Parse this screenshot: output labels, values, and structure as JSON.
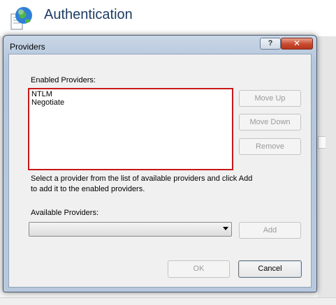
{
  "background": {
    "page_title": "Authentication"
  },
  "dialog": {
    "title": "Providers",
    "help_label": "?",
    "close_label": "✕",
    "enabled_label": "Enabled Providers:",
    "enabled_providers": [
      "NTLM",
      "Negotiate"
    ],
    "buttons": {
      "move_up": "Move Up",
      "move_down": "Move Down",
      "remove": "Remove",
      "add": "Add",
      "ok": "OK",
      "cancel": "Cancel"
    },
    "instruction_line1": "Select a provider from the list of available providers and click Add",
    "instruction_line2": "to add it to the enabled providers.",
    "available_label": "Available Providers:",
    "available_selected": ""
  },
  "colors": {
    "highlight_border": "#c81818",
    "close_button": "#c84a2f"
  }
}
